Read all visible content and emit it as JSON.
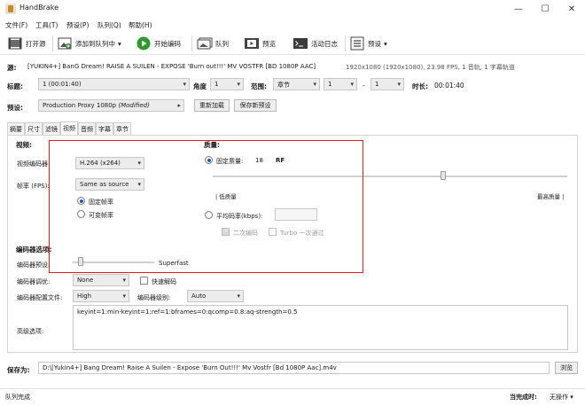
{
  "window": {
    "title": "HandBrake",
    "minimize": "—",
    "maximize": "☐",
    "close": "✕"
  },
  "menu": [
    "文件(F)",
    "工具(T)",
    "预设(P)",
    "队列(Q)",
    "帮助(H)"
  ],
  "toolbar": {
    "open_source": "打开源",
    "add_to_queue": "添加到队列中",
    "start_encode": "开始编码",
    "queue": "队列",
    "preview": "预览",
    "activity_log": "活动日志",
    "presets": "预设"
  },
  "source": {
    "label": "源:",
    "name": "[YUKIN4+] BanG Dream! RAISE A SUILEN - EXPOSE 'Burn out!!!' MV VOSTFR [BD 1080P AAC]",
    "info": "1920x1080 (1920x1080), 23.98 FPS, 1 音轨, 1 字幕轨道"
  },
  "title_row": {
    "title_label": "标题:",
    "title_value": "1 (00:01:40)",
    "angle_label": "角度",
    "angle_value": "1",
    "range_label": "范围:",
    "range_type": "章节",
    "range_from": "1",
    "range_dash": "-",
    "range_to": "1",
    "duration_label": "时长:",
    "duration_value": "00:01:40"
  },
  "preset_row": {
    "label": "预设:",
    "value": "Production Proxy 1080p",
    "modified": "(Modified)",
    "reload": "重新加载",
    "save_new": "保存新预设"
  },
  "tabs": [
    "摘要",
    "尺寸",
    "滤镜",
    "视频",
    "音频",
    "字幕",
    "章节"
  ],
  "active_tab": "视频",
  "video": {
    "section": "视频:",
    "encoder_label": "视频编码器:",
    "encoder_value": "H.264 (x264)",
    "fps_label": "帧率 (FPS):",
    "fps_value": "Same as source",
    "constant_fps": "固定帧率",
    "variable_fps": "可变帧率"
  },
  "quality": {
    "section": "质量:",
    "constant_quality": "固定质量:",
    "cq_value": "18",
    "cq_unit": "RF",
    "low_quality": "| 低质量",
    "high_quality": "最高质量 |",
    "avg_bitrate": "平均码率(kbps):",
    "two_pass": "二次编码",
    "turbo": "Turbo 一次通过"
  },
  "encoder_options": {
    "section": "编码器选项:",
    "preset_label": "编码器预设:",
    "preset_value": "Superfast",
    "tune_label": "编码器调优:",
    "tune_value": "None",
    "fast_decode": "快速解码",
    "profile_label": "编码器配置文件:",
    "profile_value": "High",
    "level_label": "编码器级别:",
    "level_value": "Auto",
    "advanced_label": "高级选项:",
    "advanced_value": "keyint=1:min-keyint=1:ref=1:bframes=0:qcomp=0.8:aq-strength=0.5"
  },
  "save": {
    "label": "保存为:",
    "path": "D:\\[Yukin4+] Bang Dream! Raise A Suilen - Expose 'Burn Out!!!' Mv Vostfr [Bd 1080P Aac].m4v",
    "browse": "浏览"
  },
  "status": {
    "left": "队列完成",
    "when_done_label": "当完成时:",
    "when_done_value": "无操作"
  },
  "colors": {
    "highlight_box": "#e02020",
    "start_green": "#2e9a2e",
    "radio_blue": "#1a5fb4"
  }
}
